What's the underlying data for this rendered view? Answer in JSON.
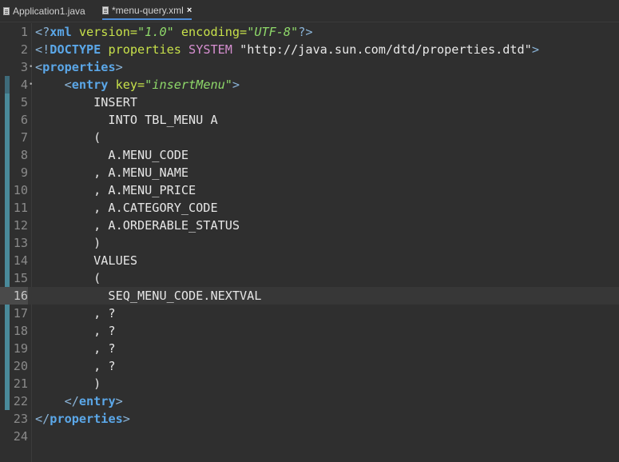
{
  "tabs": [
    {
      "label": "Application1.java",
      "active": false
    },
    {
      "label": "*menu-query.xml",
      "active": true,
      "close": "×"
    }
  ],
  "current_line": 16,
  "lines": [
    {
      "n": "1",
      "segs": [
        [
          "b",
          "<?"
        ],
        [
          "t",
          "xml"
        ],
        [
          "a",
          " version="
        ],
        [
          "s",
          "\"1.0\""
        ],
        [
          "a",
          " encoding="
        ],
        [
          "s",
          "\"UTF-8\""
        ],
        [
          "b",
          "?>"
        ]
      ]
    },
    {
      "n": "2",
      "segs": [
        [
          "b",
          "<!"
        ],
        [
          "t",
          "DOCTYPE"
        ],
        [
          "a",
          " properties"
        ],
        [
          "d",
          " SYSTEM"
        ],
        [
          "q",
          " \"http://java.sun.com/dtd/properties.dtd\""
        ],
        [
          "b",
          ">"
        ]
      ]
    },
    {
      "n": "3",
      "fold": "•",
      "segs": [
        [
          "b",
          "<"
        ],
        [
          "t",
          "properties"
        ],
        [
          "b",
          ">"
        ]
      ]
    },
    {
      "n": "4",
      "fold": "•",
      "segs": [
        [
          "x",
          "    "
        ],
        [
          "b",
          "<"
        ],
        [
          "t",
          "entry"
        ],
        [
          "a",
          " key="
        ],
        [
          "s",
          "\"insertMenu\""
        ],
        [
          "b",
          ">"
        ]
      ]
    },
    {
      "n": "5",
      "segs": [
        [
          "x",
          "        INSERT"
        ]
      ]
    },
    {
      "n": "6",
      "segs": [
        [
          "x",
          "          INTO TBL_MENU A"
        ]
      ]
    },
    {
      "n": "7",
      "segs": [
        [
          "x",
          "        ("
        ]
      ]
    },
    {
      "n": "8",
      "segs": [
        [
          "x",
          "          A.MENU_CODE"
        ]
      ]
    },
    {
      "n": "9",
      "segs": [
        [
          "x",
          "        , A.MENU_NAME"
        ]
      ]
    },
    {
      "n": "10",
      "segs": [
        [
          "x",
          "        , A.MENU_PRICE"
        ]
      ]
    },
    {
      "n": "11",
      "segs": [
        [
          "x",
          "        , A.CATEGORY_CODE"
        ]
      ]
    },
    {
      "n": "12",
      "segs": [
        [
          "x",
          "        , A.ORDERABLE_STATUS"
        ]
      ]
    },
    {
      "n": "13",
      "segs": [
        [
          "x",
          "        )"
        ]
      ]
    },
    {
      "n": "14",
      "segs": [
        [
          "x",
          "        VALUES"
        ]
      ]
    },
    {
      "n": "15",
      "segs": [
        [
          "x",
          "        ("
        ]
      ]
    },
    {
      "n": "16",
      "segs": [
        [
          "x",
          "          SEQ_MENU_CODE.NEXTVAL"
        ]
      ]
    },
    {
      "n": "17",
      "segs": [
        [
          "x",
          "        , ?"
        ]
      ]
    },
    {
      "n": "18",
      "segs": [
        [
          "x",
          "        , ?"
        ]
      ]
    },
    {
      "n": "19",
      "segs": [
        [
          "x",
          "        , ?"
        ]
      ]
    },
    {
      "n": "20",
      "segs": [
        [
          "x",
          "        , ?"
        ]
      ]
    },
    {
      "n": "21",
      "segs": [
        [
          "x",
          "        )"
        ]
      ]
    },
    {
      "n": "22",
      "segs": [
        [
          "x",
          "    "
        ],
        [
          "b",
          "</"
        ],
        [
          "t",
          "entry"
        ],
        [
          "b",
          ">"
        ]
      ]
    },
    {
      "n": "23",
      "segs": [
        [
          "b",
          "</"
        ],
        [
          "t",
          "properties"
        ],
        [
          "b",
          ">"
        ]
      ]
    },
    {
      "n": "24",
      "segs": []
    }
  ]
}
